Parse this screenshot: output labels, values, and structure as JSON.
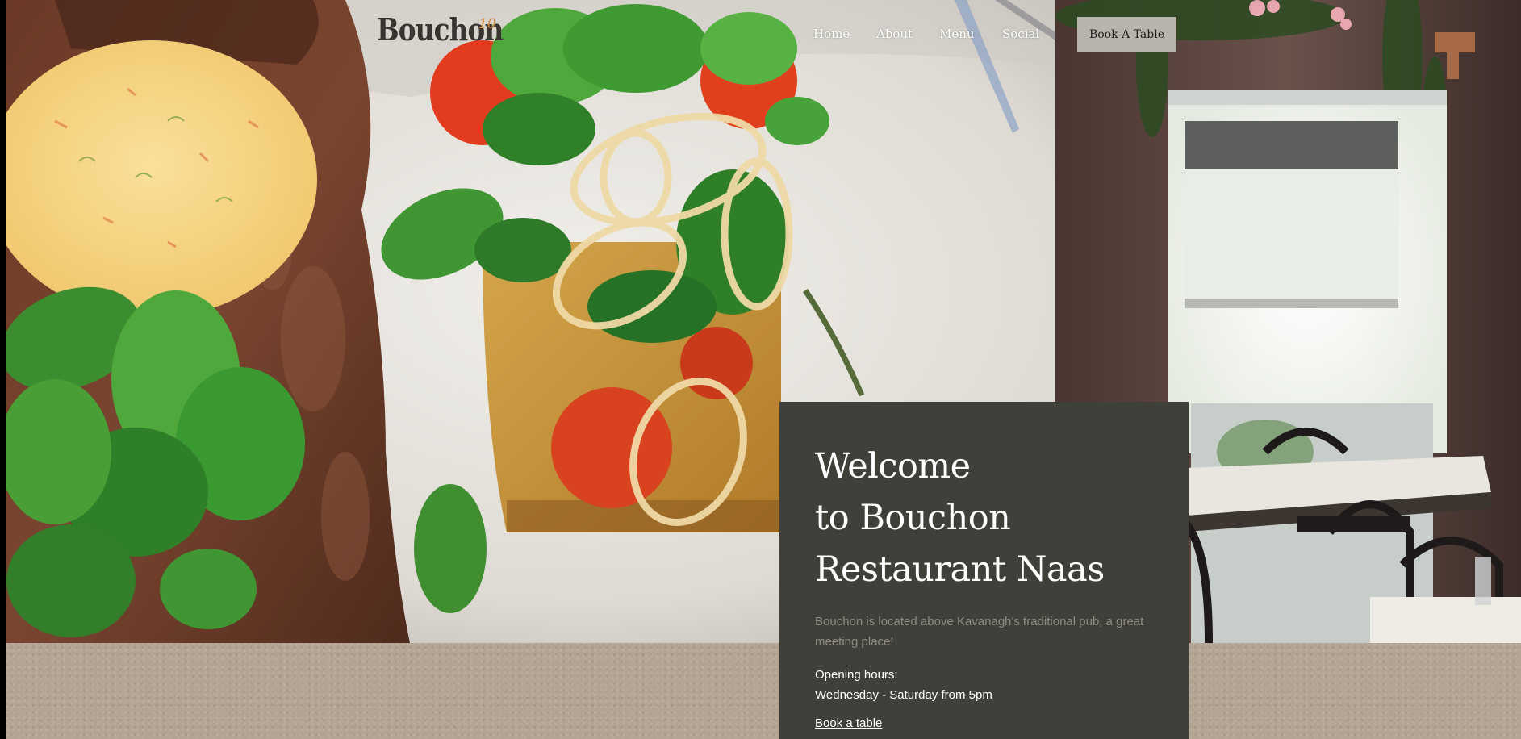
{
  "brand": {
    "name": "Bouchon",
    "superscript": "10",
    "accent_color": "#d38b3b"
  },
  "nav": {
    "items": [
      {
        "label": "Home"
      },
      {
        "label": "About"
      },
      {
        "label": "Menu"
      },
      {
        "label": "Social"
      }
    ],
    "cta_label": "Book A Table"
  },
  "welcome": {
    "title_lines": [
      "Welcome",
      "to Bouchon",
      "Restaurant Naas"
    ],
    "description": "Bouchon is located above Kavanagh's traditional pub, a great meeting place!",
    "hours_label": "Opening hours:",
    "hours": "Wednesday - Saturday from 5pm",
    "link_label": "Book a table"
  },
  "images": {
    "hero": "steak-and-salad-photo",
    "interior": "restaurant-interior-photo"
  },
  "colors": {
    "card_bg": "#40403b",
    "button_bg": "#b9b4ab",
    "sand": "#b3a594"
  }
}
